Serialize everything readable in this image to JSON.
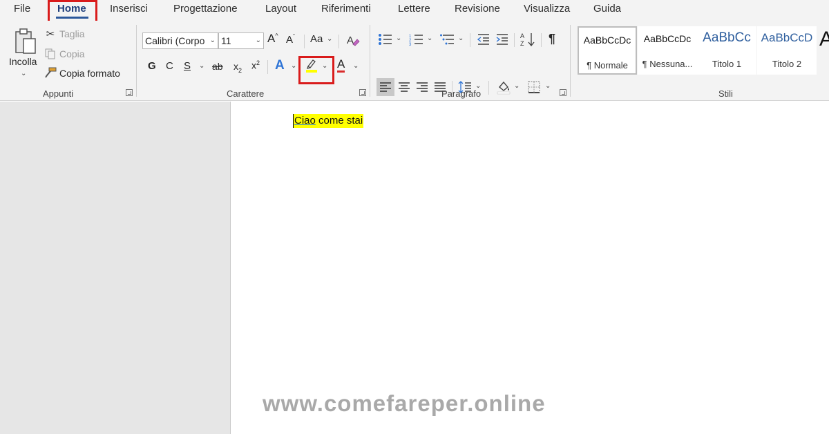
{
  "tabs": [
    {
      "label": "File"
    },
    {
      "label": "Home",
      "active": true
    },
    {
      "label": "Inserisci"
    },
    {
      "label": "Progettazione"
    },
    {
      "label": "Layout"
    },
    {
      "label": "Riferimenti"
    },
    {
      "label": "Lettere"
    },
    {
      "label": "Revisione"
    },
    {
      "label": "Visualizza"
    },
    {
      "label": "Guida"
    }
  ],
  "clipboard": {
    "paste_label": "Incolla",
    "cut_label": "Taglia",
    "copy_label": "Copia",
    "format_painter_label": "Copia formato",
    "group_label": "Appunti"
  },
  "font": {
    "family": "Calibri (Corpo",
    "size": "11",
    "grow_label": "A",
    "shrink_label": "A",
    "case_label": "Aa",
    "bold_label": "G",
    "italic_label": "C",
    "underline_label": "S",
    "strike_label": "ab",
    "subscript_label": "x",
    "superscript_label": "x",
    "effects_label": "A",
    "font_color_label": "A",
    "highlight_color": "#ffff00",
    "font_color": "#d92b2b",
    "group_label": "Carattere"
  },
  "paragraph": {
    "pilcrow": "¶",
    "group_label": "Paragrafo"
  },
  "styles": {
    "items": [
      {
        "sample": "AaBbCcDc",
        "name": "¶ Normale"
      },
      {
        "sample": "AaBbCcDc",
        "name": "¶ Nessuna..."
      },
      {
        "sample": "AaBbCc",
        "name": "Titolo 1"
      },
      {
        "sample": "AaBbCcD",
        "name": "Titolo 2"
      }
    ],
    "group_label": "Stili"
  },
  "document": {
    "text_first": "Ciao",
    "text_rest": " come stai"
  },
  "watermark": "www.comefareper.online",
  "colors": {
    "accent": "#2b579a",
    "annotation_red": "#d91b1b",
    "highlight": "#ffff00"
  }
}
